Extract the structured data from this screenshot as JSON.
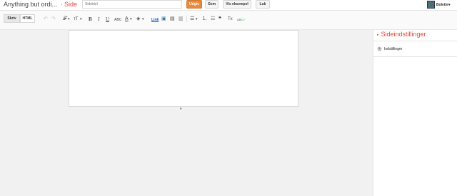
{
  "topbar": {
    "blog_title": "Anything but ordi...",
    "crumb_dash": "·",
    "crumb_label": "Side",
    "title_placeholder": "Sidetitel",
    "publish_label": "Udgiv",
    "save_label": "Gem",
    "preview_label": "Vis eksempel",
    "close_label": "Luk",
    "username": "Bolette▾"
  },
  "toolbar": {
    "mode_write": "Skriv",
    "mode_html": "HTML",
    "undo": "↶",
    "redo": "↷",
    "font": "𝓕",
    "font_size": "ᴛT",
    "bold": "B",
    "italic": "I",
    "underline": "U",
    "strike": "ABC",
    "text_color": "A",
    "highlight": "◈",
    "link": "Link",
    "image": "▣",
    "video": "▤",
    "special": "▥",
    "align": "☰",
    "numbered": "⒈",
    "bullets": "☷",
    "quote": "❝",
    "clear_format": "Tx",
    "spell": "ABC✓",
    "caret": "▾"
  },
  "sidebar": {
    "heading_marker": "▸",
    "heading": "Sideindstillinger",
    "item_label": "Indstillinger"
  },
  "editor": {
    "resize_marker": "▾"
  },
  "colors": {
    "accent": "#dd4b39",
    "publish": "#e98a3a",
    "link": "#1155cc"
  }
}
